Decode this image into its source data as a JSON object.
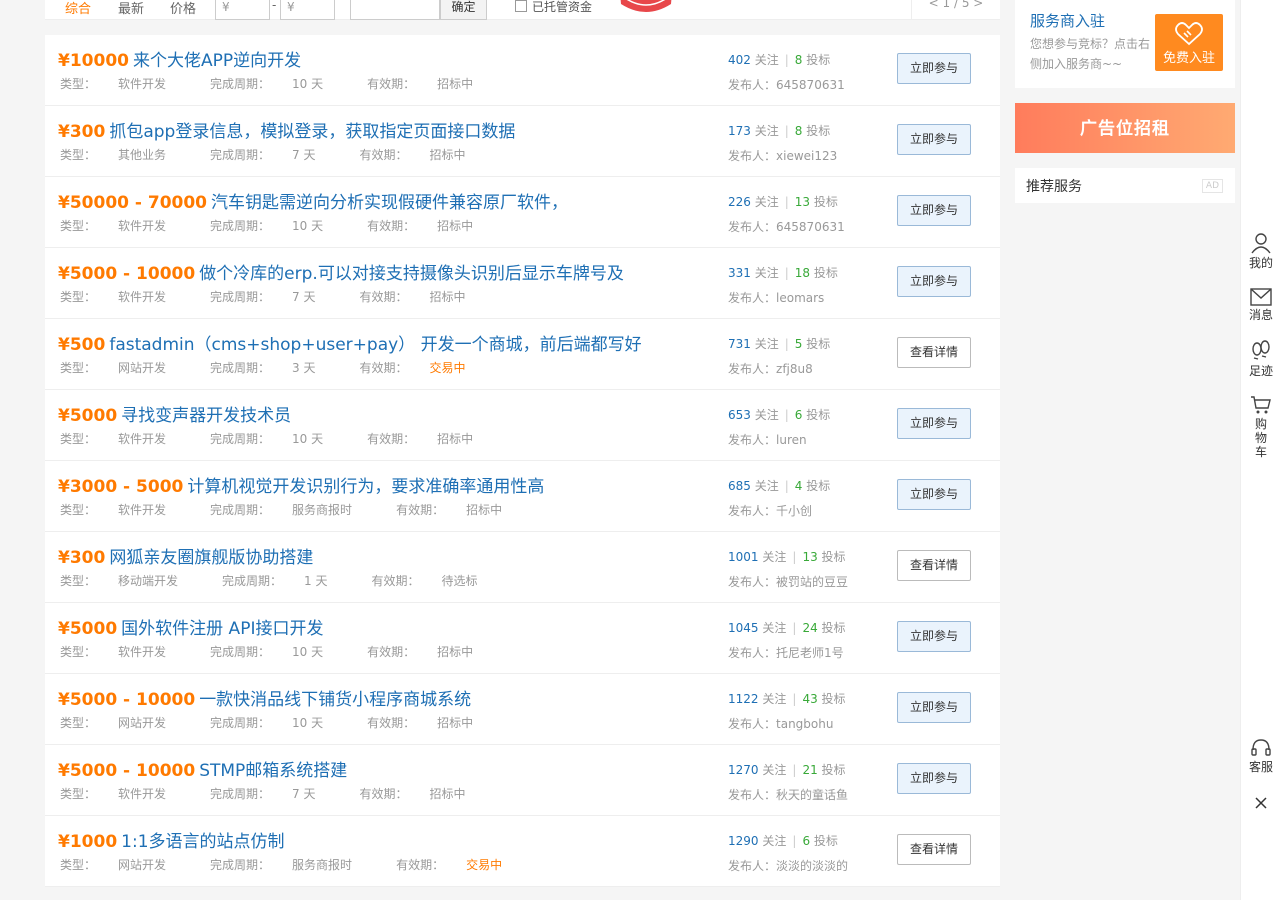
{
  "filter": {
    "tabs": [
      "综合",
      "最新",
      "价格"
    ],
    "price_min_placeholder": "¥",
    "price_max_placeholder": "¥",
    "dash": "-",
    "confirm_label": "确定",
    "checkbox_label": "已托管资金",
    "pager": "< 1 / 5 >"
  },
  "labels": {
    "type_prefix": "类型：",
    "period_prefix": "完成周期：",
    "validity_prefix": "有效期：",
    "follow_word": "关注",
    "bid_word": "投标",
    "publisher_prefix": "发布人："
  },
  "accent": "#ff7a00",
  "link_color": "#1e6fb4",
  "tasks": [
    {
      "price": "¥10000",
      "title": "来个大佬APP逆向开发",
      "type": "软件开发",
      "period": "10 天",
      "status": "招标中",
      "status_highlight": false,
      "follows": "402",
      "bids": "8",
      "publisher": "645870631",
      "button": "立即参与",
      "button_kind": "join"
    },
    {
      "price": "¥300",
      "title": "抓包app登录信息，模拟登录，获取指定页面接口数据",
      "type": "其他业务",
      "period": "7 天",
      "status": "招标中",
      "status_highlight": false,
      "follows": "173",
      "bids": "8",
      "publisher": "xiewei123",
      "button": "立即参与",
      "button_kind": "join"
    },
    {
      "price": "¥50000 - 70000",
      "title": "汽车钥匙需逆向分析实现假硬件兼容原厂软件，",
      "type": "软件开发",
      "period": "10 天",
      "status": "招标中",
      "status_highlight": false,
      "follows": "226",
      "bids": "13",
      "publisher": "645870631",
      "button": "立即参与",
      "button_kind": "join"
    },
    {
      "price": "¥5000 - 10000",
      "title": "做个冷库的erp.可以对接支持摄像头识别后显示车牌号及",
      "type": "软件开发",
      "period": "7 天",
      "status": "招标中",
      "status_highlight": false,
      "follows": "331",
      "bids": "18",
      "publisher": "leomars",
      "button": "立即参与",
      "button_kind": "join"
    },
    {
      "price": "¥500",
      "title": "fastadmin（cms+shop+user+pay） 开发一个商城，前后端都写好",
      "type": "网站开发",
      "period": "3 天",
      "status": "交易中",
      "status_highlight": true,
      "follows": "731",
      "bids": "5",
      "publisher": "zfj8u8",
      "button": "查看详情",
      "button_kind": "detail"
    },
    {
      "price": "¥5000",
      "title": "寻找变声器开发技术员",
      "type": "软件开发",
      "period": "10 天",
      "status": "招标中",
      "status_highlight": false,
      "follows": "653",
      "bids": "6",
      "publisher": "luren",
      "button": "立即参与",
      "button_kind": "join"
    },
    {
      "price": "¥3000 - 5000",
      "title": "计算机视觉开发识别行为，要求准确率通用性高",
      "type": "软件开发",
      "period": "服务商报时",
      "status": "招标中",
      "status_highlight": false,
      "follows": "685",
      "bids": "4",
      "publisher": "千小创",
      "button": "立即参与",
      "button_kind": "join"
    },
    {
      "price": "¥300",
      "title": "网狐亲友圈旗舰版协助搭建",
      "type": "移动端开发",
      "period": "1 天",
      "status": "待选标",
      "status_highlight": false,
      "follows": "1001",
      "bids": "13",
      "publisher": "被罚站的豆豆",
      "button": "查看详情",
      "button_kind": "detail"
    },
    {
      "price": "¥5000",
      "title": "国外软件注册 API接口开发",
      "type": "软件开发",
      "period": "10 天",
      "status": "招标中",
      "status_highlight": false,
      "follows": "1045",
      "bids": "24",
      "publisher": "托尼老师1号",
      "button": "立即参与",
      "button_kind": "join"
    },
    {
      "price": "¥5000 - 10000",
      "title": "一款快消品线下铺货小程序商城系统",
      "type": "网站开发",
      "period": "10 天",
      "status": "招标中",
      "status_highlight": false,
      "follows": "1122",
      "bids": "43",
      "publisher": "tangbohu",
      "button": "立即参与",
      "button_kind": "join"
    },
    {
      "price": "¥5000 - 10000",
      "title": "STMP邮箱系统搭建",
      "type": "软件开发",
      "period": "7 天",
      "status": "招标中",
      "status_highlight": false,
      "follows": "1270",
      "bids": "21",
      "publisher": "秋天的童话鱼",
      "button": "立即参与",
      "button_kind": "join"
    },
    {
      "price": "¥1000",
      "title": "1:1多语言的站点仿制",
      "type": "网站开发",
      "period": "服务商报时",
      "status": "交易中",
      "status_highlight": true,
      "follows": "1290",
      "bids": "6",
      "publisher": "淡淡的淡淡的",
      "button": "查看详情",
      "button_kind": "detail"
    }
  ],
  "sidebar": {
    "provider_title": "服务商入驻",
    "provider_desc": "您想参与竞标？点击右侧加入服务商~~",
    "provider_button": "免费入驻",
    "ad_banner": "广告位招租",
    "recommend_title": "推荐服务",
    "ad_tag": "AD"
  },
  "toolbar": {
    "mine": "我的",
    "messages": "消息",
    "footprint": "足迹",
    "cart": "购物车",
    "service": "客服"
  }
}
